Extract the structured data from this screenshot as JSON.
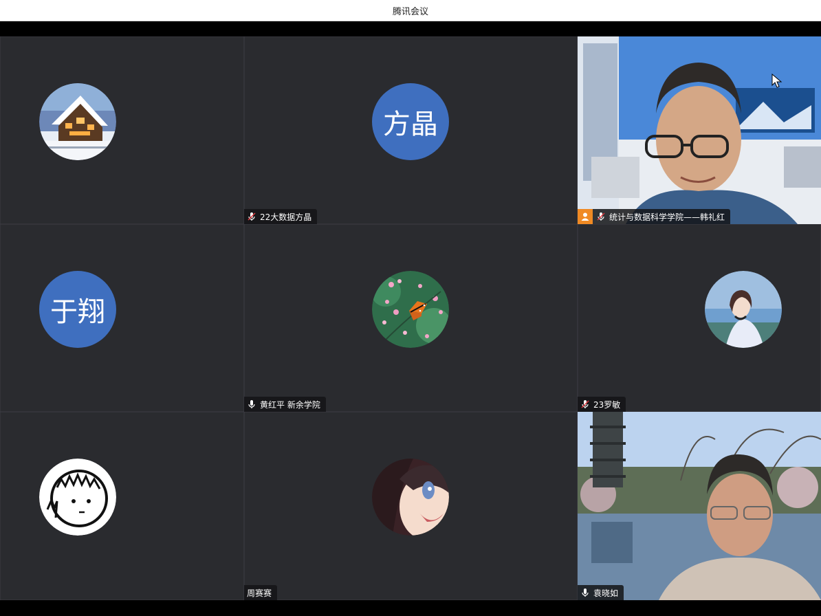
{
  "window": {
    "title": "腾讯会议"
  },
  "participants": [
    {
      "name": "",
      "avatar": "snow-cabin-photo",
      "mic": "none"
    },
    {
      "name": "22大数据方晶",
      "avatar_text": "方晶",
      "mic": "muted"
    },
    {
      "name": "统计与数据科学学院——韩礼红",
      "avatar": "video",
      "mic": "muted",
      "host": true
    },
    {
      "name": "",
      "avatar_text": "于翔",
      "mic": "none"
    },
    {
      "name": "黄红平 新余学院",
      "avatar": "butterfly-photo",
      "mic": "on"
    },
    {
      "name": "23罗敏",
      "avatar": "anime-girl-photo",
      "mic": "muted"
    },
    {
      "name": "",
      "avatar": "cartoon-boy-drawing",
      "mic": "none"
    },
    {
      "name": "周赛赛",
      "avatar": "anime-character-photo",
      "mic": "none"
    },
    {
      "name": "袁晓如",
      "avatar": "video",
      "mic": "on"
    }
  ],
  "colors": {
    "tile_bg": "#2a2b2f",
    "avatar_blue": "#3f6fbf",
    "host_orange": "#f08a24",
    "muted_red": "#e0383e"
  }
}
